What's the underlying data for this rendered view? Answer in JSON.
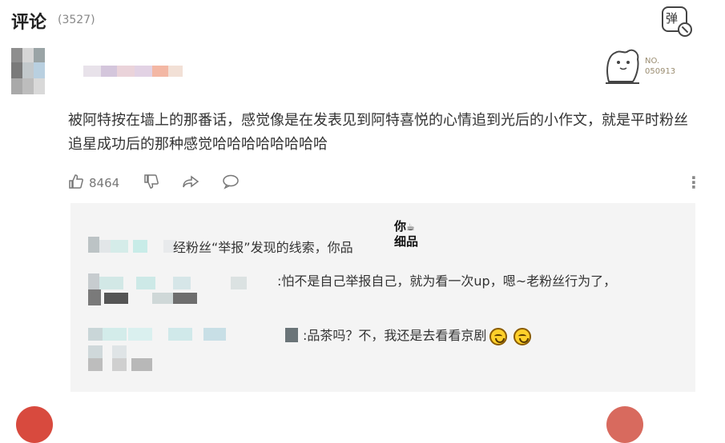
{
  "header": {
    "title": "评论",
    "count": "(3527)",
    "danmu_icon": "danmu-toggle-icon"
  },
  "comment": {
    "badge_text": "NO. 050913",
    "text": "被阿特按在墙上的那番话，感觉像是在发表见到阿特喜悦的心情追到光后的小作文，就是平时粉丝追星成功后的那种感觉哈哈哈哈哈哈哈哈",
    "likes": "8464",
    "icons": [
      "thumb-up-icon",
      "thumb-down-icon",
      "share-icon",
      "reply-icon",
      "more-icon"
    ]
  },
  "replies": [
    {
      "text": "经粉丝“举报”发现的线索，你品",
      "sticker": "你品细品"
    },
    {
      "text": ":怕不是自己举报自己，就为看一次up，嗯~老粉丝行为了，"
    },
    {
      "text": ":品茶吗？不，我还是去看看京剧",
      "emoji": "grin-emoji"
    }
  ]
}
